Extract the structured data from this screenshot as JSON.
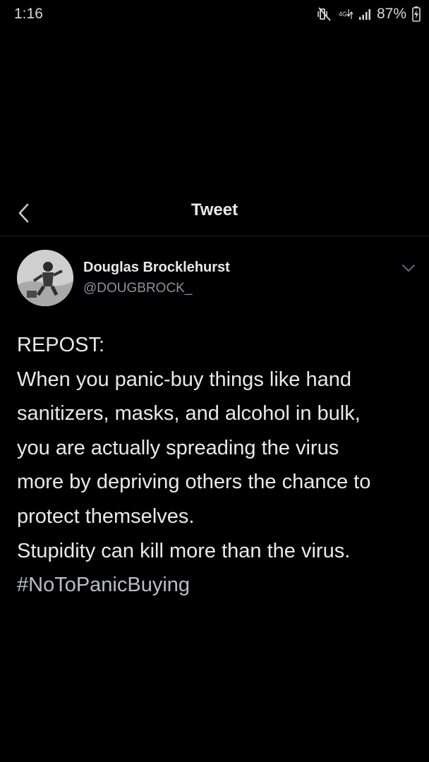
{
  "status_bar": {
    "time": "1:16",
    "network": "4G",
    "battery": "87%",
    "icons": [
      "mute-vibrate-icon",
      "network-4g-icon",
      "signal-icon",
      "battery-charging-icon"
    ]
  },
  "header": {
    "title": "Tweet",
    "back_icon": "chevron-left-icon"
  },
  "tweet": {
    "author": {
      "name": "Douglas Brocklehurst",
      "handle": "@DOUGBROCK_"
    },
    "lines": [
      "REPOST:",
      "When you panic-buy things like hand",
      "sanitizers, masks, and alcohol in bulk,",
      "you are actually spreading the virus",
      "more by depriving others the chance to",
      "protect themselves.",
      "Stupidity can kill more than the virus."
    ],
    "hashtag": "#NoToPanicBuying"
  },
  "colors": {
    "background": "#000000",
    "text": "#e7e9ea",
    "secondary": "#8b9298",
    "divider": "#1c1f23"
  }
}
